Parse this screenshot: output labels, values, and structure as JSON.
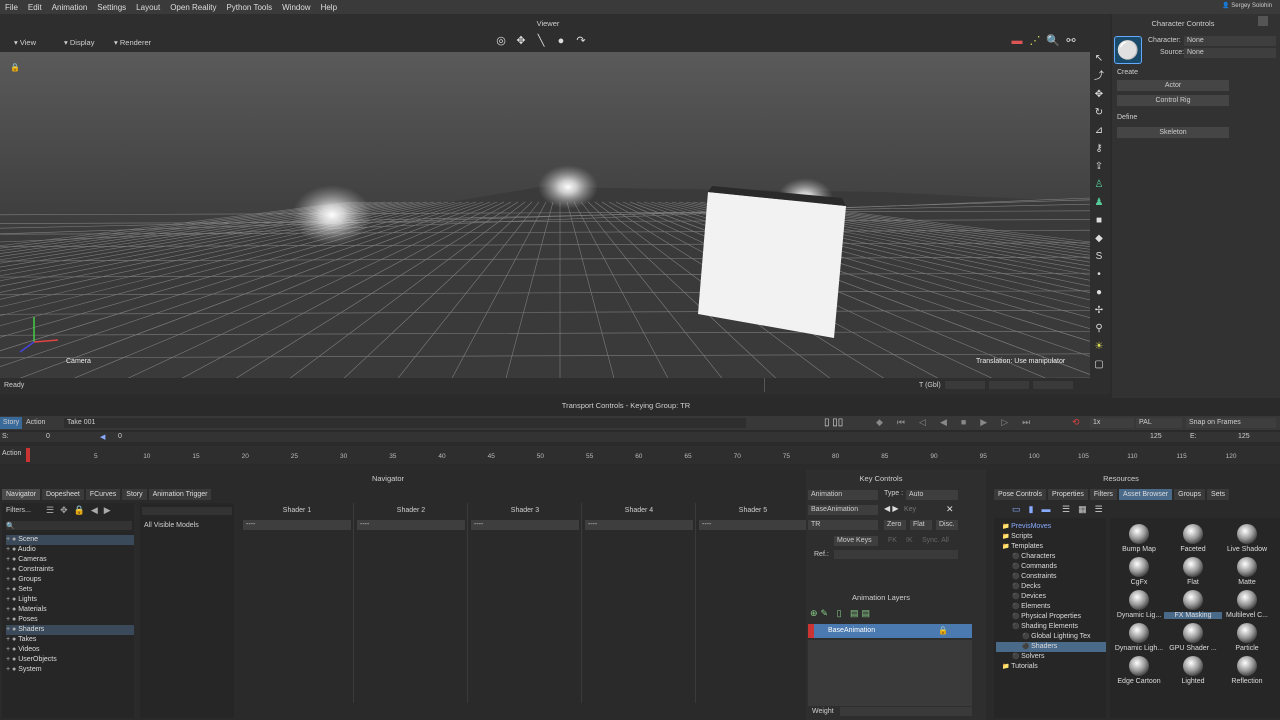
{
  "menu": [
    "File",
    "Edit",
    "Animation",
    "Settings",
    "Layout",
    "Open Reality",
    "Python Tools",
    "Window",
    "Help"
  ],
  "user": "Sergey Solohin",
  "viewer": {
    "title": "Viewer",
    "buttons": [
      "View",
      "Display",
      "Renderer"
    ],
    "camera_label": "Camera",
    "status": "Ready",
    "hint": "Translation: Use manipulator",
    "coord_label": "T (Gbl)"
  },
  "character_controls": {
    "title": "Character Controls",
    "character_label": "Character:",
    "character_value": "None",
    "source_label": "Source:",
    "source_value": "None",
    "create_label": "Create",
    "actor_btn": "Actor",
    "control_rig_btn": "Control Rig",
    "define_label": "Define",
    "skeleton_btn": "Skeleton"
  },
  "transport": {
    "title": "Transport Controls  -  Keying Group: TR",
    "story": "Story",
    "action": "Action",
    "take": "Take 001",
    "speed": "1x",
    "fps": "PAL",
    "snap": "Snap on Frames",
    "start_label": "S:",
    "start": "0",
    "cur": "0",
    "end_val": "125",
    "end_label": "E:",
    "end": "125",
    "ruler_label": "Action",
    "ticks": [
      "5",
      "10",
      "15",
      "20",
      "25",
      "30",
      "35",
      "40",
      "45",
      "50",
      "55",
      "60",
      "65",
      "70",
      "75",
      "80",
      "85",
      "90",
      "95",
      "100",
      "105",
      "110",
      "115",
      "120"
    ]
  },
  "navigator": {
    "title": "Navigator",
    "tabs": [
      "Navigator",
      "Dopesheet",
      "FCurves",
      "Story",
      "Animation Trigger"
    ],
    "filters": "Filters...",
    "tree": [
      "Scene",
      "Audio",
      "Cameras",
      "Constraints",
      "Groups",
      "Sets",
      "Lights",
      "Materials",
      "Poses",
      "Shaders",
      "Takes",
      "Videos",
      "UserObjects",
      "System"
    ],
    "models": "All Visible Models",
    "shaders": [
      "Shader 1",
      "Shader 2",
      "Shader 3",
      "Shader 4",
      "Shader 5"
    ],
    "shader_default": "----"
  },
  "key_controls": {
    "title": "Key Controls",
    "animation": "Animation",
    "type_label": "Type :",
    "type_value": "Auto",
    "layer": "BaseAnimation",
    "key_label": "Key",
    "tr": "TR",
    "zero": "Zero",
    "flat": "Flat",
    "disc": "Disc.",
    "move_keys": "Move Keys",
    "fk": "FK",
    "ik": "IK",
    "sync": "Sync. All",
    "ref": "Ref.:"
  },
  "animation_layers": {
    "title": "Animation Layers",
    "layer": "BaseAnimation",
    "weight": "Weight"
  },
  "resources": {
    "title": "Resources",
    "tabs": [
      "Pose Controls",
      "Properties",
      "Filters",
      "Asset Browser",
      "Groups",
      "Sets"
    ],
    "tree": [
      "PrevisMoves",
      "Scripts",
      "Templates",
      "Characters",
      "Commands",
      "Constraints",
      "Decks",
      "Devices",
      "Elements",
      "Physical Properties",
      "Shading Elements",
      "Global Lighting Tex",
      "Shaders",
      "Solvers",
      "Tutorials"
    ],
    "assets": [
      "Bump Map",
      "Faceted",
      "Live Shadow",
      "CgFx",
      "Flat",
      "Matte",
      "Dynamic Lig...",
      "FX Masking",
      "Multilevel C...",
      "Dynamic Ligh...",
      "GPU Shader ...",
      "Particle",
      "Edge Cartoon",
      "Lighted",
      "Reflection"
    ]
  }
}
